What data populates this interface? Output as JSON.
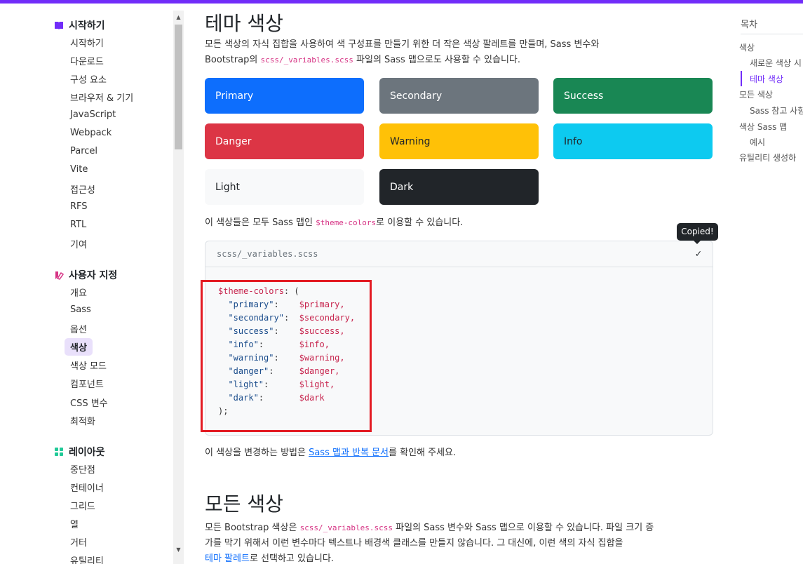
{
  "colors": {
    "accent": "#712cf9",
    "primary": "#0d6efd",
    "secondary": "#6c757d",
    "success": "#198754",
    "danger": "#dc3545",
    "warning": "#ffc107",
    "info": "#0dcaf0",
    "light": "#f8f9fa",
    "dark": "#212529",
    "highlight": "#e31b23"
  },
  "sidebar": {
    "groups": [
      {
        "title": "시작하기",
        "icon": "book-icon",
        "items": [
          "시작하기",
          "다운로드",
          "구성 요소",
          "브라우저 & 기기",
          "JavaScript",
          "Webpack",
          "Parcel",
          "Vite",
          "접근성",
          "RFS",
          "RTL",
          "기여"
        ]
      },
      {
        "title": "사용자 지정",
        "icon": "palette-icon",
        "items": [
          "개요",
          "Sass",
          "옵션",
          "색상",
          "색상 모드",
          "컴포넌트",
          "CSS 변수",
          "최적화"
        ],
        "active": "색상"
      },
      {
        "title": "레이아웃",
        "icon": "grid-icon",
        "items": [
          "중단점",
          "컨테이너",
          "그리드",
          "열",
          "거터",
          "유틸리티"
        ]
      }
    ]
  },
  "main": {
    "section1": {
      "heading": "테마 색상",
      "intro_part1": "모든 색상의 자식 집합을 사용하여 색 구성표를 만들기 위한 더 작은 색상 팔레트를 만들며, Sass 변수와",
      "intro_part2_prefix": "Bootstrap의 ",
      "intro_code": "scss/_variables.scss",
      "intro_part2_suffix": " 파일의 Sass 맵으로도 사용할 수 있습니다.",
      "swatches": [
        "Primary",
        "Secondary",
        "Success",
        "Danger",
        "Warning",
        "Info",
        "Light",
        "Dark"
      ],
      "map_text_prefix": "이 색상들은 모두 Sass 맵인 ",
      "map_code": "$theme-colors",
      "map_text_suffix": "로 이용할 수 있습니다.",
      "codebox": {
        "filename": "scss/_variables.scss",
        "tooltip": "Copied!",
        "check_icon": "✓",
        "var_name": "$theme-colors",
        "entries": [
          {
            "key": "\"primary\"",
            "value": "$primary,"
          },
          {
            "key": "\"secondary\"",
            "value": "$secondary,"
          },
          {
            "key": "\"success\"",
            "value": "$success,"
          },
          {
            "key": "\"info\"",
            "value": "$info,"
          },
          {
            "key": "\"warning\"",
            "value": "$warning,"
          },
          {
            "key": "\"danger\"",
            "value": "$danger,"
          },
          {
            "key": "\"light\"",
            "value": "$light,"
          },
          {
            "key": "\"dark\"",
            "value": "$dark"
          }
        ]
      },
      "change_prefix": "이 색상을 변경하는 방법은 ",
      "change_link": "Sass 맵과 반복 문서",
      "change_suffix": "를 확인해 주세요."
    },
    "section2": {
      "heading": "모든 색상",
      "line1_prefix": "모든 Bootstrap 색상은 ",
      "line1_code": "scss/_variables.scss",
      "line1_suffix": " 파일의 Sass 변수와 Sass 맵으로 이용할 수 있습니다. 파일 크기 증",
      "line2": "가를 막기 위해서 이런 변수마다 텍스트나 배경색 클래스를 만들지 않습니다. 그 대신에, 이런 색의 자식 집합을",
      "line3_link": "테마 팔레트",
      "line3_suffix": "로 선택하고 있습니다."
    }
  },
  "toc": {
    "title": "목차",
    "items": [
      {
        "label": "색상",
        "level": 1
      },
      {
        "label": "새로운 색상 시",
        "level": 2
      },
      {
        "label": "테마 색상",
        "level": 2,
        "active": true
      },
      {
        "label": "모든 색상",
        "level": 1
      },
      {
        "label": "Sass 참고 사항",
        "level": 2
      },
      {
        "label": "색상 Sass 맵",
        "level": 1
      },
      {
        "label": "예시",
        "level": 2
      },
      {
        "label": "유틸리티 생성하",
        "level": 1
      }
    ]
  }
}
